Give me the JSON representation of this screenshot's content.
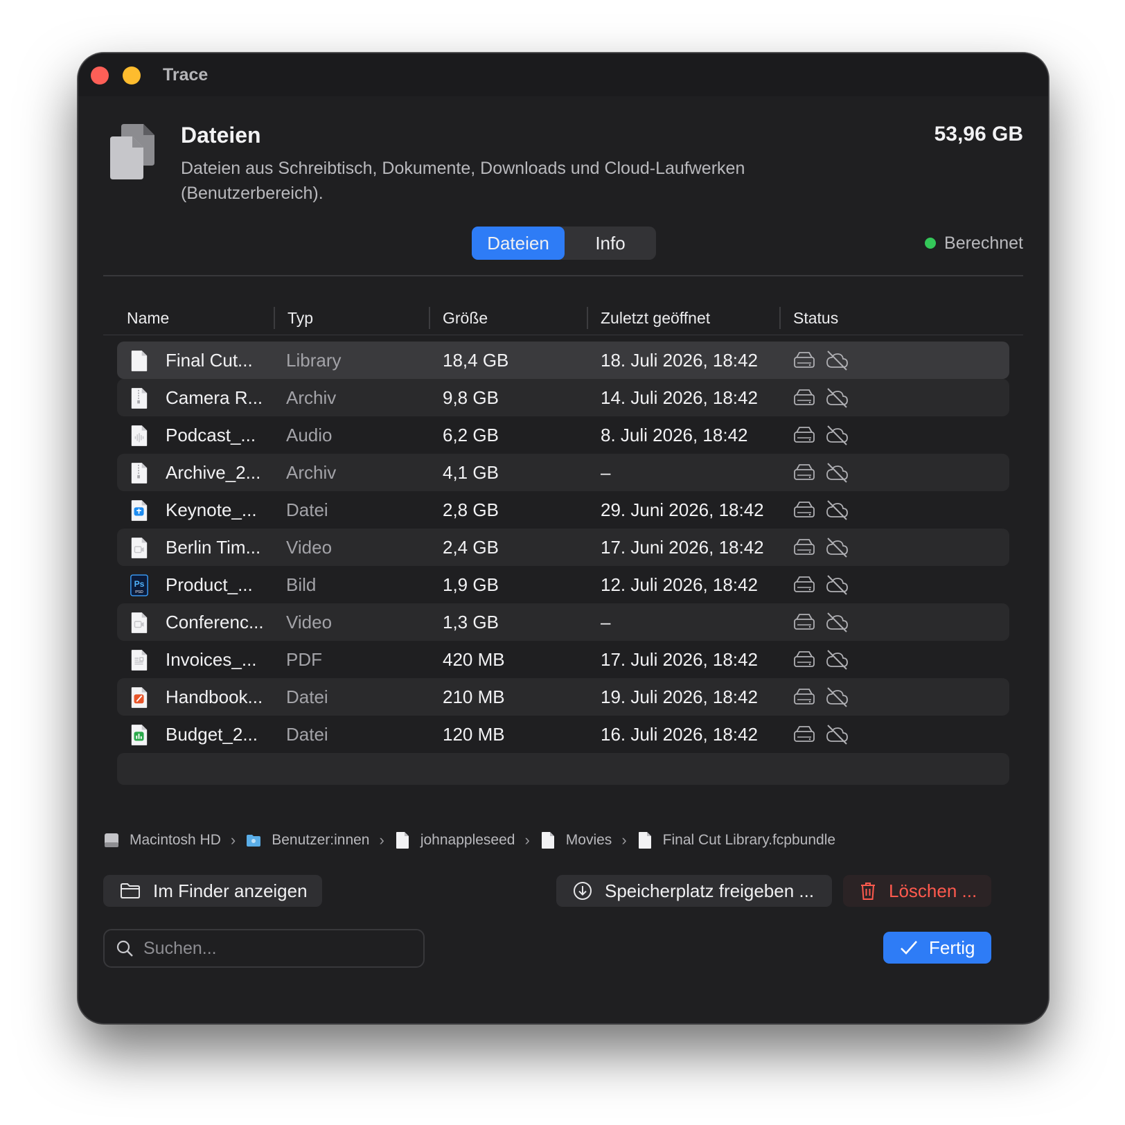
{
  "window": {
    "title": "Trace"
  },
  "header": {
    "title": "Dateien",
    "description": "Dateien aus Schreibtisch, Dokumente, Downloads und Cloud-Laufwerken (Benutzerbereich).",
    "total_size": "53,96 GB",
    "icon": "documents-icon"
  },
  "tabs": [
    {
      "label": "Dateien",
      "active": true
    },
    {
      "label": "Info",
      "active": false
    }
  ],
  "status": {
    "label": "Berechnet",
    "color": "#34c759"
  },
  "table": {
    "columns": [
      "Name",
      "Typ",
      "Größe",
      "Zuletzt geöffnet",
      "Status"
    ],
    "rows": [
      {
        "name": "Final Cut...",
        "type": "Library",
        "size": "18,4 GB",
        "opened": "18. Juli 2026, 18:42",
        "icon": "file-icon",
        "selected": true
      },
      {
        "name": "Camera R...",
        "type": "Archiv",
        "size": "9,8 GB",
        "opened": "14. Juli 2026, 18:42",
        "icon": "archive-file-icon"
      },
      {
        "name": "Podcast_...",
        "type": "Audio",
        "size": "6,2 GB",
        "opened": "8. Juli 2026, 18:42",
        "icon": "audio-file-icon"
      },
      {
        "name": "Archive_2...",
        "type": "Archiv",
        "size": "4,1 GB",
        "opened": "–",
        "icon": "archive-file-icon"
      },
      {
        "name": "Keynote_...",
        "type": "Datei",
        "size": "2,8 GB",
        "opened": "29. Juni 2026, 18:42",
        "icon": "keynote-file-icon"
      },
      {
        "name": "Berlin Tim...",
        "type": "Video",
        "size": "2,4 GB",
        "opened": "17. Juni 2026, 18:42",
        "icon": "video-file-icon"
      },
      {
        "name": "Product_...",
        "type": "Bild",
        "size": "1,9 GB",
        "opened": "12. Juli 2026, 18:42",
        "icon": "psd-file-icon",
        "icon_text": "Ps",
        "icon_subtext": "PSD"
      },
      {
        "name": "Conferenc...",
        "type": "Video",
        "size": "1,3 GB",
        "opened": "–",
        "icon": "video-file-icon"
      },
      {
        "name": "Invoices_...",
        "type": "PDF",
        "size": "420 MB",
        "opened": "17. Juli 2026, 18:42",
        "icon": "pdf-file-icon"
      },
      {
        "name": "Handbook...",
        "type": "Datei",
        "size": "210 MB",
        "opened": "19. Juli 2026, 18:42",
        "icon": "pages-file-icon"
      },
      {
        "name": "Budget_2...",
        "type": "Datei",
        "size": "120 MB",
        "opened": "16. Juli 2026, 18:42",
        "icon": "numbers-file-icon"
      }
    ],
    "status_icons": [
      "drive-icon",
      "cloud-off-icon"
    ]
  },
  "breadcrumb": [
    {
      "label": "Macintosh HD",
      "icon": "hard-drive-icon"
    },
    {
      "label": "Benutzer:innen",
      "icon": "folder-icon"
    },
    {
      "label": "johnappleseed",
      "icon": "file-icon"
    },
    {
      "label": "Movies",
      "icon": "file-icon"
    },
    {
      "label": "Final Cut Library.fcpbundle",
      "icon": "file-icon"
    }
  ],
  "actions": {
    "finder": "Im Finder anzeigen",
    "free_space": "Speicherplatz freigeben ...",
    "delete": "Löschen ...",
    "done": "Fertig"
  },
  "search": {
    "placeholder": "Suchen...",
    "value": ""
  },
  "colors": {
    "accent": "#2e7cf6",
    "danger": "#ff5a4e",
    "background": "#1f1f21"
  }
}
